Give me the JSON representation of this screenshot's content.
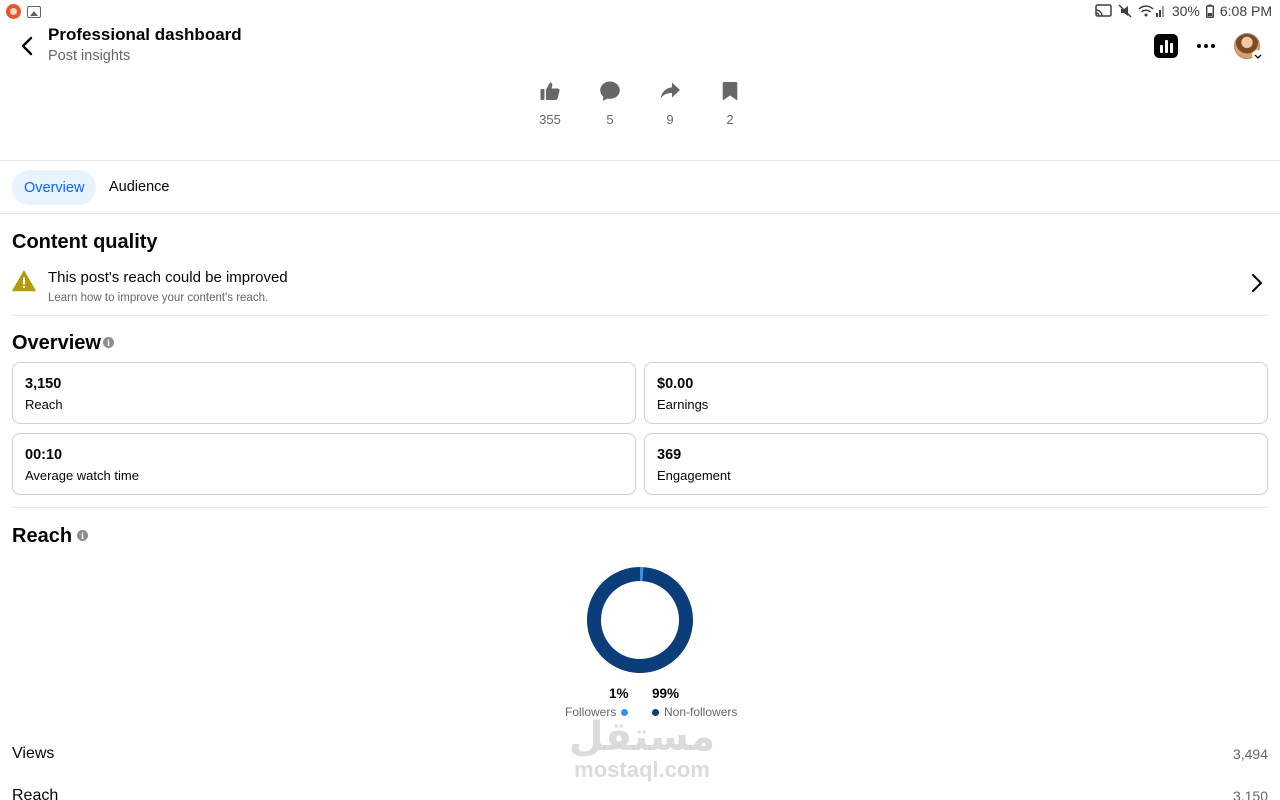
{
  "status_bar": {
    "battery": "30%",
    "time": "6:08 PM"
  },
  "header": {
    "title": "Professional dashboard",
    "subtitle": "Post insights"
  },
  "engagement": [
    {
      "icon": "like-icon",
      "count": "355"
    },
    {
      "icon": "comment-icon",
      "count": "5"
    },
    {
      "icon": "share-icon",
      "count": "9"
    },
    {
      "icon": "bookmark-icon",
      "count": "2"
    }
  ],
  "tabs": [
    {
      "label": "Overview",
      "active": true
    },
    {
      "label": "Audience",
      "active": false
    }
  ],
  "content_quality": {
    "title": "Content quality",
    "alert_title": "This post's reach could be improved",
    "alert_subtitle": "Learn how to improve your content's reach."
  },
  "overview": {
    "title": "Overview",
    "cards": [
      {
        "value": "3,150",
        "label": "Reach"
      },
      {
        "value": "$0.00",
        "label": "Earnings"
      },
      {
        "value": "00:10",
        "label": "Average watch time"
      },
      {
        "value": "369",
        "label": "Engagement"
      }
    ]
  },
  "reach": {
    "title": "Reach",
    "chart_data": {
      "type": "pie",
      "categories": [
        "Followers",
        "Non-followers"
      ],
      "values": [
        1,
        99
      ],
      "labels": [
        "1%",
        "99%"
      ],
      "colors": [
        "#3b8ef0",
        "#0a3d7a"
      ],
      "title": ""
    },
    "metrics": [
      {
        "label": "Views",
        "value": "3,494"
      },
      {
        "label": "Reach",
        "value": "3,150"
      }
    ]
  },
  "watermark": {
    "arabic": "مستقل",
    "latin": "mostaql.com"
  }
}
